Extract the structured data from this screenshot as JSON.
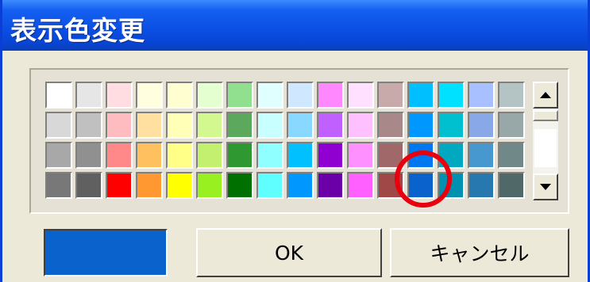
{
  "window": {
    "title": "表示色変更"
  },
  "palette": {
    "rows": [
      [
        "#ffffff",
        "#e6e6e6",
        "#ffdde0",
        "#ffffe0",
        "#fffed0",
        "#e4ffd0",
        "#90e090",
        "#e0ffff",
        "#d0e8ff",
        "#ff88ff",
        "#ffe0ff",
        "#c8aaaa",
        "#00bfff",
        "#00e0ff",
        "#a8c0ff",
        "#b4c4c4"
      ],
      [
        "#d8d8d8",
        "#c0c0c0",
        "#ffbcc0",
        "#ffe0a0",
        "#ffffb8",
        "#d4f890",
        "#5ca85c",
        "#c8ffff",
        "#88d8ff",
        "#c060ff",
        "#ffc0ff",
        "#a88888",
        "#0098ff",
        "#00c0d0",
        "#88a8e8",
        "#98a8a8"
      ],
      [
        "#a8a8a8",
        "#909090",
        "#ff8888",
        "#ffc060",
        "#ffff88",
        "#c4f070",
        "#309830",
        "#90ffff",
        "#00c0ff",
        "#9000d0",
        "#ff90ff",
        "#a06868",
        "#0078f0",
        "#00a8c0",
        "#4898d0",
        "#708888"
      ],
      [
        "#787878",
        "#606060",
        "#ff0000",
        "#ff9830",
        "#ffff00",
        "#98f020",
        "#007000",
        "#60ffff",
        "#0098ff",
        "#6c00a8",
        "#ff60ff",
        "#a04848",
        "#0a63cc",
        "#0090b0",
        "#2878b0",
        "#506868"
      ]
    ],
    "selected_color": "#0a63cc"
  },
  "scrollbar": {
    "up_icon": "arrow-up-icon",
    "down_icon": "arrow-down-icon"
  },
  "buttons": {
    "ok_label": "OK",
    "cancel_label": "キャンセル"
  },
  "annotation": {
    "ring_color": "#e8000f"
  }
}
